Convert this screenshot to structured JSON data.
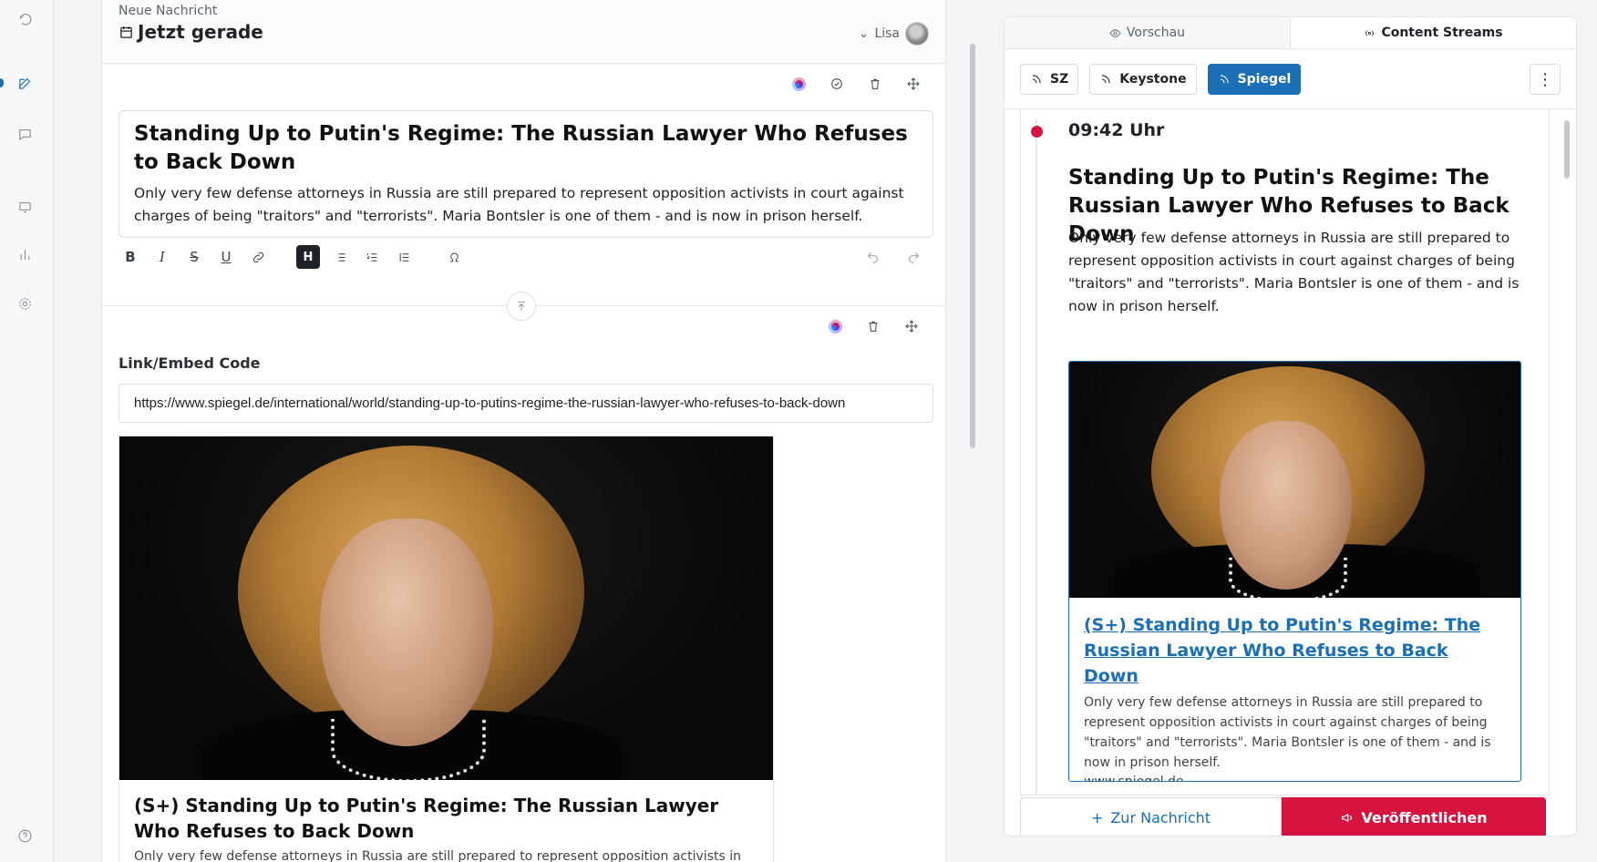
{
  "editor": {
    "kicker": "Neue Nachricht",
    "when": "Jetzt gerade",
    "user": "Lisa",
    "headline": "Standing Up to Putin's Regime: The Russian Lawyer Who Refuses to Back Down",
    "lead": "Only very few defense attorneys in Russia are still prepared to represent opposition activists in court against charges of being \"traitors\" and \"terrorists\". Maria Bontsler is one of them - and is now in prison herself.",
    "format_buttons": [
      "B",
      "I",
      "S",
      "U",
      "H"
    ],
    "embed_label": "Link/Embed Code",
    "embed_url": "https://www.spiegel.de/international/world/standing-up-to-putins-regime-the-russian-lawyer-who-refuses-to-back-down",
    "card_title": "(S+) Standing Up to Putin's Regime: The Russian Lawyer Who Refuses to Back Down",
    "card_desc": "Only very few defense attorneys in Russia are still prepared to represent opposition activists in court"
  },
  "right": {
    "tabs": [
      "Vorschau",
      "Content Streams"
    ],
    "active_tab": "Content Streams",
    "streams": [
      "SZ",
      "Keystone",
      "Spiegel"
    ],
    "active_stream": "Spiegel",
    "time": "09:42 Uhr",
    "headline": "Standing Up to Putin's Regime: The Russian Lawyer Who Refuses to Back Down",
    "lead": "Only very few defense attorneys in Russia are still prepared to represent opposition activists in court against charges of being \"traitors\" and \"terrorists\". Maria Bontsler is one of them - and is now in prison herself.",
    "card_title": "(S+) Standing Up to Putin's Regime: The Russian Lawyer Who Refuses to Back Down",
    "card_desc": "Only very few defense attorneys in Russia are still prepared to represent opposition activists in court against charges of being \"traitors\" and \"terrorists\". Maria Bontsler is one of them - and is now in prison herself.",
    "card_source": "www.spiegel.de",
    "btn_secondary": "Zur Nachricht",
    "btn_primary": "Veröffentlichen"
  },
  "colors": {
    "accent_blue": "#1a6fb5",
    "accent_red": "#d6133f"
  }
}
